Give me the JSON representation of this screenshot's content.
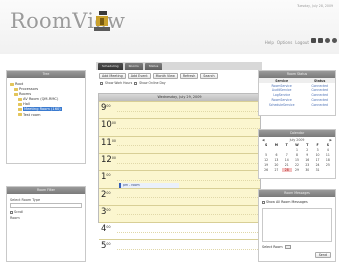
{
  "header": {
    "logo_text": "RoomView",
    "date": "Tuesday, July 28, 2009",
    "subtitle": "",
    "links": [
      "Help",
      "Options",
      "Logout"
    ]
  },
  "tree": {
    "title": "Tree",
    "items": [
      {
        "label": "Root",
        "level": 1
      },
      {
        "label": "Processors",
        "level": 2
      },
      {
        "label": "Rooms",
        "level": 2
      },
      {
        "label": "AV Room (QM-RMC)",
        "level": 3
      },
      {
        "label": "Hall",
        "level": 3
      },
      {
        "label": "Meeting Room (160)",
        "level": 3,
        "selected": true
      },
      {
        "label": "Test room",
        "level": 3
      }
    ]
  },
  "filter": {
    "title": "Room Filter",
    "label": "Select Room Type",
    "options": [
      "Scroll",
      "Room"
    ]
  },
  "tabs": [
    "Scheduling",
    "Rooms",
    "Status"
  ],
  "toolbar": {
    "buttons": [
      "Add Meeting",
      "Add Event",
      "Month View",
      "Refresh",
      "Search"
    ],
    "checks": [
      "Show Work Hours",
      "Show Online Day"
    ]
  },
  "calendar": {
    "header": "Wednesday, July 29, 2009",
    "hours": [
      "9",
      "10",
      "11",
      "12",
      "1",
      "2",
      "3",
      "4",
      "5"
    ],
    "hour_suffix": "00",
    "event": "pm - room"
  },
  "status": {
    "title": "Room Status",
    "columns": [
      "Service",
      "Status"
    ],
    "rows": [
      [
        "RoomService",
        "Connected"
      ],
      [
        "AuditService",
        "Connected"
      ],
      [
        "LogService",
        "Connected"
      ],
      [
        "RoomService",
        "Connected"
      ],
      [
        "ScheduleService",
        "Connected"
      ]
    ]
  },
  "mini_calendar": {
    "title": "Calendar",
    "month": "July 2009",
    "days_header": [
      "S",
      "M",
      "T",
      "W",
      "T",
      "F",
      "S"
    ],
    "days": [
      "",
      "",
      "",
      "1",
      "2",
      "3",
      "4",
      "5",
      "6",
      "7",
      "8",
      "9",
      "10",
      "11",
      "12",
      "13",
      "14",
      "15",
      "16",
      "17",
      "18",
      "19",
      "20",
      "21",
      "22",
      "23",
      "24",
      "25",
      "26",
      "27",
      "28",
      "29",
      "30",
      "31",
      ""
    ],
    "today": "28"
  },
  "messages": {
    "title": "Room Messages",
    "check_label": "Show All Room Messages",
    "select_label": "Select Room",
    "send_label": "Send"
  }
}
